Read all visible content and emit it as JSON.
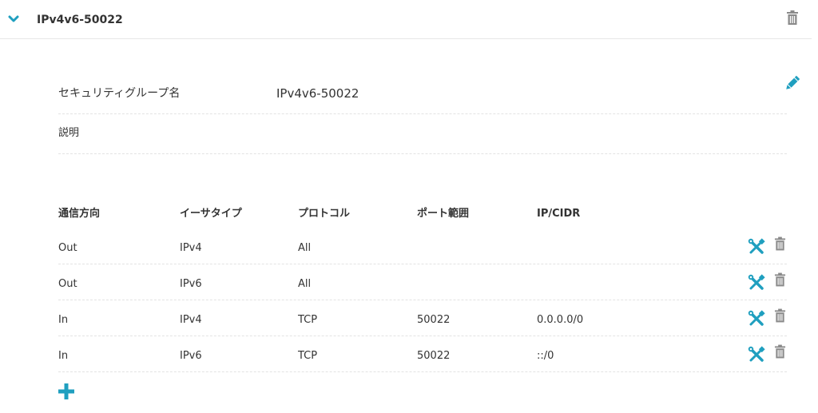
{
  "group": {
    "title": "IPv4v6-50022",
    "fields": {
      "name_label": "セキュリティグループ名",
      "name_value": "IPv4v6-50022",
      "description_label": "説明",
      "description_value": ""
    }
  },
  "rules": {
    "columns": {
      "direction": "通信方向",
      "ethertype": "イーサタイプ",
      "protocol": "プロトコル",
      "port_range": "ポート範囲",
      "ip_cidr": "IP/CIDR"
    },
    "rows": [
      {
        "direction": "Out",
        "ethertype": "IPv4",
        "protocol": "All",
        "port_range": "",
        "ip_cidr": ""
      },
      {
        "direction": "Out",
        "ethertype": "IPv6",
        "protocol": "All",
        "port_range": "",
        "ip_cidr": ""
      },
      {
        "direction": "In",
        "ethertype": "IPv4",
        "protocol": "TCP",
        "port_range": "50022",
        "ip_cidr": "0.0.0.0/0"
      },
      {
        "direction": "In",
        "ethertype": "IPv6",
        "protocol": "TCP",
        "port_range": "50022",
        "ip_cidr": "::/0"
      }
    ]
  },
  "icons": {
    "collapse": "chevron-down-icon",
    "delete": "trash-icon",
    "edit": "pencil-icon",
    "rule_edit": "wrench-screwdriver-icon",
    "add": "plus-icon"
  },
  "colors": {
    "accent": "#1f9fbf",
    "icon_gray": "#8a8a8a",
    "text": "#333333",
    "divider": "#e3e3e3"
  }
}
